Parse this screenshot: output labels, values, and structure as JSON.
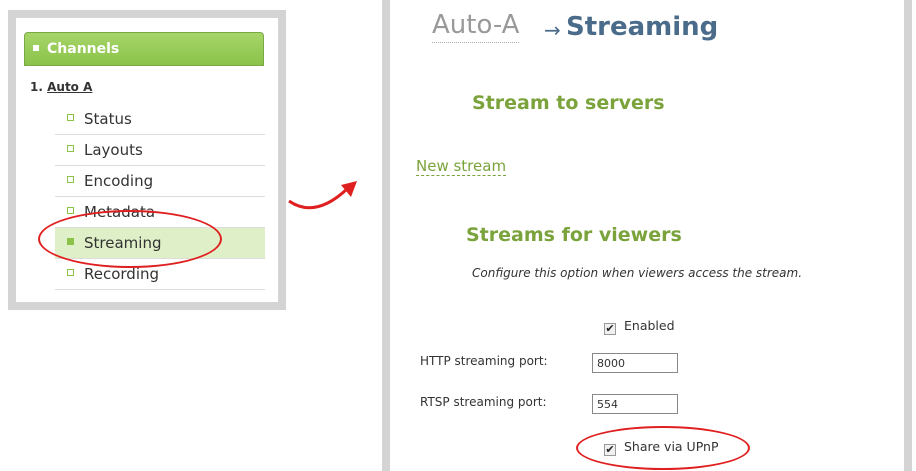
{
  "sidebar": {
    "header": "Channels",
    "channel_number": "1.",
    "channel_name": "Auto A",
    "items": [
      {
        "label": "Status"
      },
      {
        "label": "Layouts"
      },
      {
        "label": "Encoding"
      },
      {
        "label": "Metadata"
      },
      {
        "label": "Streaming"
      },
      {
        "label": "Recording"
      }
    ],
    "active_item": "Streaming"
  },
  "main": {
    "breadcrumb": "Auto-A",
    "breadcrumb_arrow": "→",
    "title": "Streaming",
    "stream_to_servers_heading": "Stream to servers",
    "new_stream_link": "New stream",
    "streams_for_viewers_heading": "Streams for viewers",
    "note": "Configure this option when viewers access the stream.",
    "enabled_label": "Enabled",
    "enabled_checked": true,
    "http_port_label": "HTTP streaming port:",
    "http_port_value": "8000",
    "rtsp_port_label": "RTSP streaming port:",
    "rtsp_port_value": "554",
    "upnp_label": "Share via UPnP",
    "upnp_checked": true
  },
  "colors": {
    "accent_green": "#8bc34a",
    "heading_green": "#7ba33c",
    "title_blue": "#4a6b8a",
    "highlight_red": "#e02020"
  }
}
